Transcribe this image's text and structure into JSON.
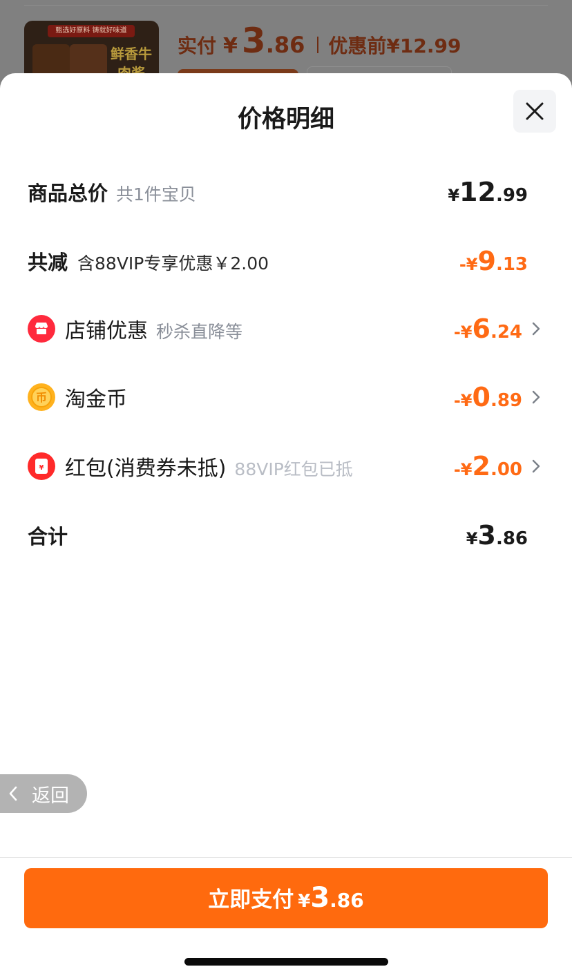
{
  "background": {
    "thumb_banner": "甄选好原料 铸就好味道",
    "thumb_title": "鲜香牛肉酱",
    "paid_label": "实付",
    "paid_currency": "¥",
    "paid_int": "3",
    "paid_dec": ".86",
    "original_label": "优惠前",
    "original_price": "¥12.99"
  },
  "sheet": {
    "title": "价格明细",
    "close_icon": "close-icon"
  },
  "rows": {
    "total": {
      "label": "商品总价",
      "note": "共1件宝贝",
      "cur": "¥",
      "int": "12",
      "dec": ".99"
    },
    "reduce": {
      "label": "共减",
      "note": "含88VIP专享优惠￥2.00",
      "cur": "-¥",
      "int": "9",
      "dec": ".13"
    },
    "shop": {
      "label": "店铺优惠",
      "note": "秒杀直降等",
      "cur": "-¥",
      "int": "6",
      "dec": ".24",
      "icon": "shop-icon",
      "icon_color": "#ff2a3d"
    },
    "coin": {
      "label": "淘金币",
      "cur": "-¥",
      "int": "0",
      "dec": ".89",
      "icon": "coin-icon",
      "icon_color": "#ffb21e"
    },
    "redpacket": {
      "label": "红包(消费券未抵)",
      "note": "88VIP红包已抵",
      "cur": "-¥",
      "int": "2",
      "dec": ".00",
      "icon": "red-packet-icon",
      "icon_color": "#ff2a2a"
    },
    "sum": {
      "label": "合计",
      "cur": "¥",
      "int": "3",
      "dec": ".86"
    }
  },
  "back": {
    "label": "返回"
  },
  "pay": {
    "label": "立即支付",
    "cur": "¥",
    "int": "3",
    "dec": ".86"
  },
  "colors": {
    "accent": "#ff6a0e",
    "discount": "#ff6a14"
  }
}
